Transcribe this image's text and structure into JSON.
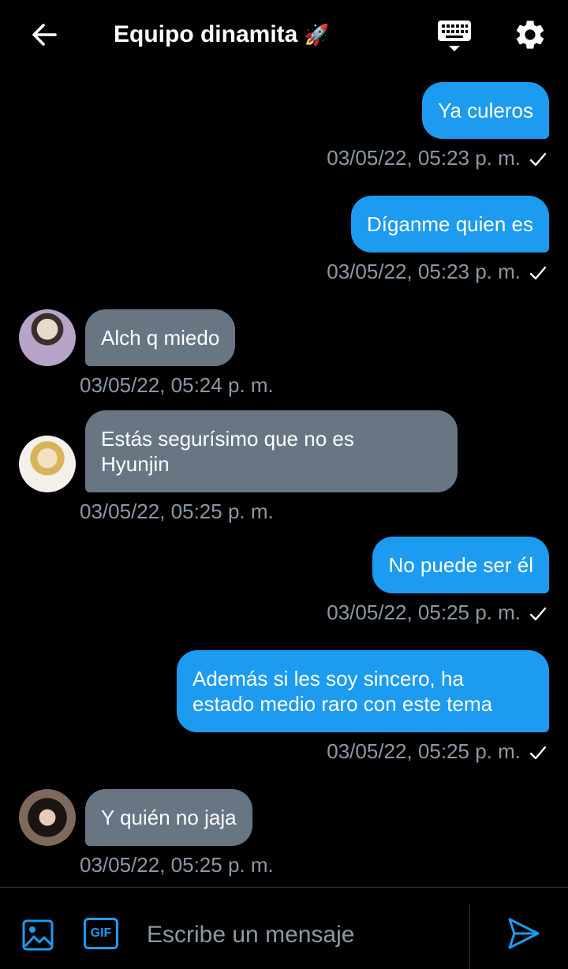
{
  "header": {
    "title": "Equipo dinamita",
    "title_emoji": "🚀"
  },
  "messages": [
    {
      "direction": "outgoing",
      "text": "Ya culeros",
      "timestamp": "03/05/22, 05:23 p. m.",
      "read": true
    },
    {
      "direction": "outgoing",
      "text": "Díganme quien es",
      "timestamp": "03/05/22, 05:23 p. m.",
      "read": true
    },
    {
      "direction": "incoming",
      "text": "Alch q miedo",
      "timestamp": "03/05/22, 05:24 p. m."
    },
    {
      "direction": "incoming",
      "text_line1": "Estás segurísimo que no es",
      "text_line2": "Hyunjin",
      "timestamp": "03/05/22, 05:25 p. m."
    },
    {
      "direction": "outgoing",
      "text": "No puede ser él",
      "timestamp": "03/05/22, 05:25 p. m.",
      "read": true
    },
    {
      "direction": "outgoing",
      "text_line1": "Además si les soy sincero, ha",
      "text_line2": "estado medio raro con este tema",
      "timestamp": "03/05/22, 05:25 p. m.",
      "read": true
    },
    {
      "direction": "incoming",
      "text": "Y quién no jaja",
      "timestamp": "03/05/22, 05:25 p. m."
    }
  ],
  "composer": {
    "placeholder": "Escribe un mensaje",
    "gif_label": "GIF"
  },
  "icons": {
    "back": "arrow-left-icon",
    "keyboard": "keyboard-icon",
    "settings": "gear-icon",
    "image": "image-icon",
    "send": "send-icon",
    "read": "check-icon"
  },
  "colors": {
    "outgoing_bubble": "#1d9bf0",
    "incoming_bubble": "#687684",
    "timestamp": "#8b98a5",
    "accent": "#1d9bf0"
  }
}
